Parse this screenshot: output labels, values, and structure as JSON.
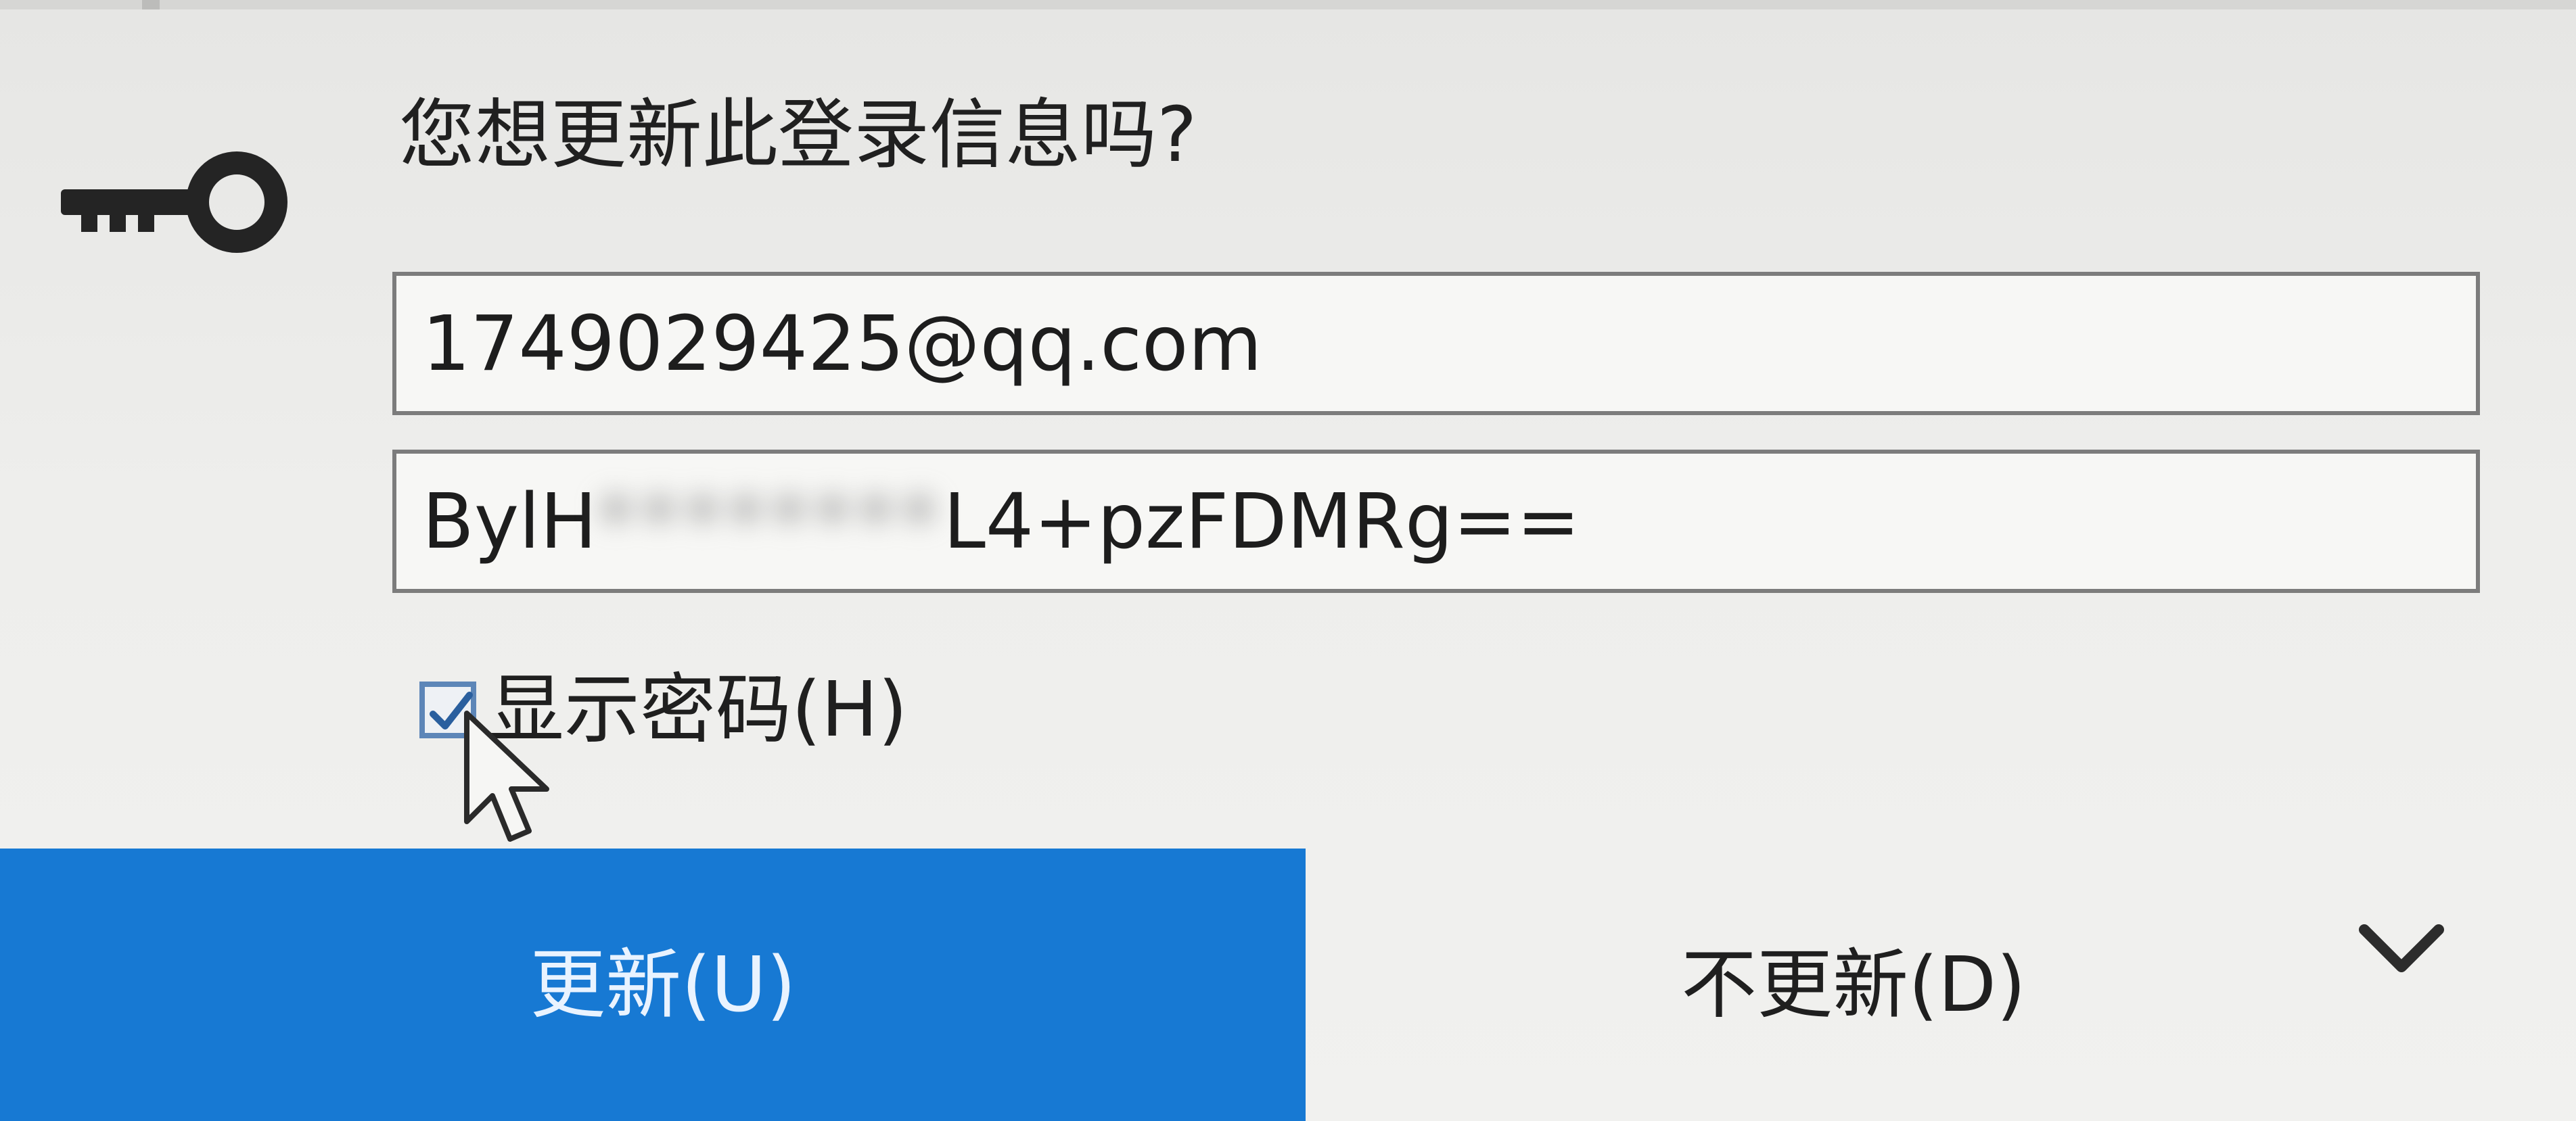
{
  "dialog": {
    "title": "您想更新此登录信息吗?",
    "icon": "key-icon"
  },
  "username": {
    "value": "1749029425@qq.com"
  },
  "password": {
    "value_start": "BylH",
    "value_redacted": "********",
    "value_end": "L4+pzFDMRg=="
  },
  "show_password": {
    "label": "显示密码(H)",
    "checked": true
  },
  "actions": {
    "update_label": "更新(U)",
    "no_update_label": "不更新(D)",
    "more_icon": "chevron-down-icon"
  },
  "colors": {
    "primary_button": "#1779d3",
    "background": "#eeeeec",
    "field_border": "#7c7c7c"
  }
}
